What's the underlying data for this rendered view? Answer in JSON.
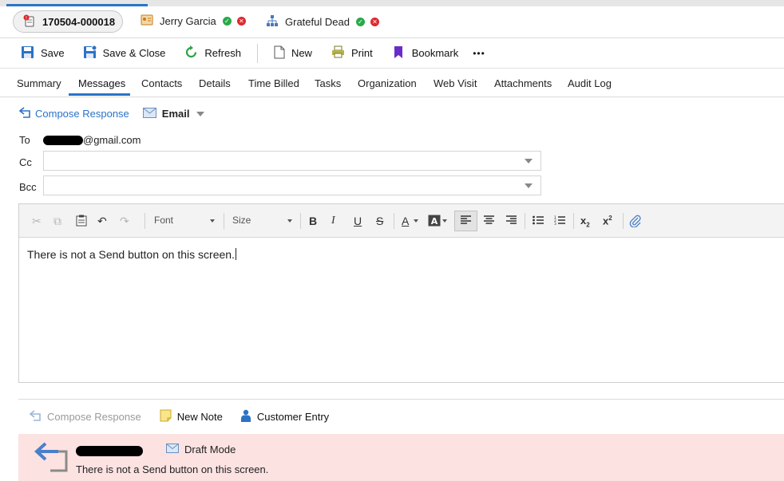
{
  "record_tabs": {
    "ticket_number": "170504-000018",
    "contact_name": "Jerry Garcia",
    "organization_name": "Grateful Dead"
  },
  "toolbar": {
    "save": "Save",
    "save_close": "Save & Close",
    "refresh": "Refresh",
    "new": "New",
    "print": "Print",
    "bookmark": "Bookmark",
    "more": "•••"
  },
  "nav_tabs": [
    "Summary",
    "Messages",
    "Contacts",
    "Details",
    "Time Billed",
    "Tasks",
    "Organization",
    "Web Visit",
    "Attachments",
    "Audit Log"
  ],
  "active_tab": "Messages",
  "compose": {
    "compose_response": "Compose Response",
    "channel": "Email",
    "to_label": "To",
    "to_value_suffix": "@gmail.com",
    "cc_label": "Cc",
    "cc_value": "",
    "bcc_label": "Bcc",
    "bcc_value": ""
  },
  "editor": {
    "font_label": "Font",
    "size_label": "Size",
    "body_text": "There is not a Send button on this screen."
  },
  "bottom_actions": {
    "compose_response": "Compose Response",
    "new_note": "New Note",
    "customer_entry": "Customer Entry"
  },
  "draft": {
    "mode_label": "Draft Mode",
    "body_text": "There is not a Send button on this screen."
  },
  "colors": {
    "accent": "#2b73c7",
    "draft_background": "#fde2e2",
    "ok_green": "#2aa94a",
    "error_red": "#e0282e",
    "bookmark_purple": "#6a2bc9"
  }
}
